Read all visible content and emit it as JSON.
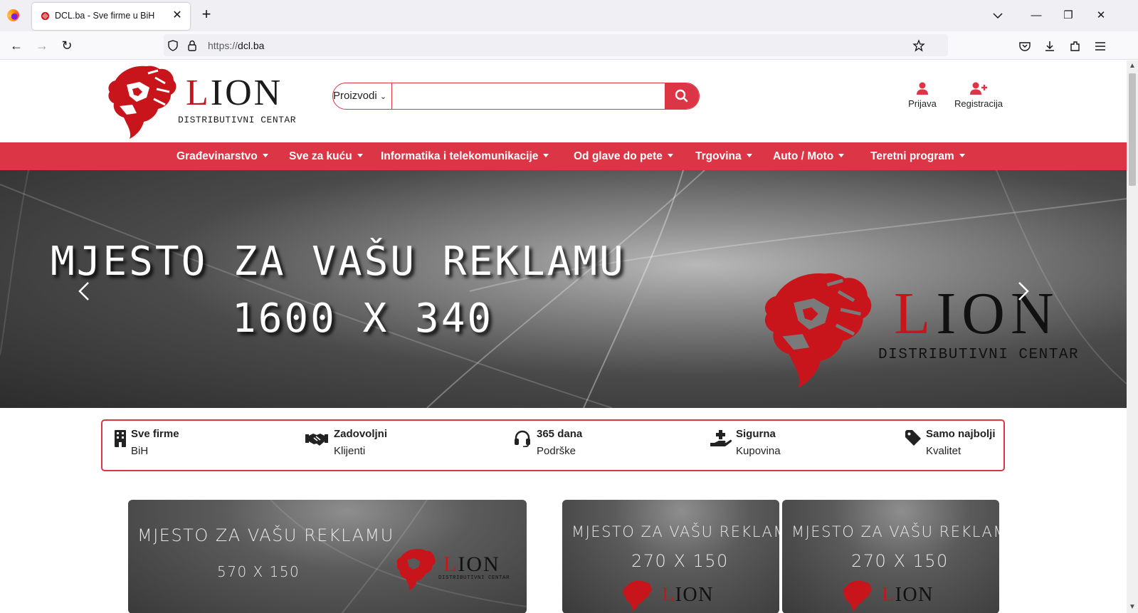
{
  "browser": {
    "tab_title": "DCL.ba - Sve firme u BiH",
    "url_scheme": "https://",
    "url_host": "dcl.ba"
  },
  "site": {
    "logo_first_letter": "L",
    "logo_rest": "ION",
    "logo_subtitle": "DISTRIBUTIVNI CENTAR",
    "search_category": "Proizvodi",
    "search_placeholder": "",
    "login_label": "Prijava",
    "register_label": "Registracija",
    "accent_color": "#dc3545"
  },
  "categories": [
    "Građevinarstvo",
    "Sve za kuću",
    "Informatika i telekomunikacije",
    "Od glave do pete",
    "Trgovina",
    "Auto / Moto",
    "Teretni program"
  ],
  "hero": {
    "line1": "MJESTO ZA VAŠU REKLAMU",
    "line2": "1600 X 340",
    "logo_first_letter": "L",
    "logo_rest": "ION",
    "logo_subtitle": "DISTRIBUTIVNI CENTAR"
  },
  "features": [
    {
      "title": "Sve firme",
      "subtitle": "BiH",
      "icon": "building-icon"
    },
    {
      "title": "Zadovoljni",
      "subtitle": "Klijenti",
      "icon": "handshake-icon"
    },
    {
      "title": "365 dana",
      "subtitle": "Podrške",
      "icon": "headset-icon"
    },
    {
      "title": "Sigurna",
      "subtitle": "Kupovina",
      "icon": "hand-holding-medical-icon"
    },
    {
      "title": "Samo najbolji",
      "subtitle": "Kvalitet",
      "icon": "tag-icon"
    }
  ],
  "banners": [
    {
      "line1": "MJESTO ZA VAŠU REKLAMU",
      "line2": "570 X 150",
      "logo_first_letter": "L",
      "logo_rest": "ION",
      "logo_subtitle": "DISTRIBUTIVNI CENTAR"
    },
    {
      "line1": "MJESTO ZA VAŠU REKLAMU",
      "line2": "270 X 150",
      "logo_first_letter": "L",
      "logo_rest": "ION"
    },
    {
      "line1": "MJESTO ZA VAŠU REKLAMU",
      "line2": "270 X 150",
      "logo_first_letter": "L",
      "logo_rest": "ION"
    }
  ]
}
